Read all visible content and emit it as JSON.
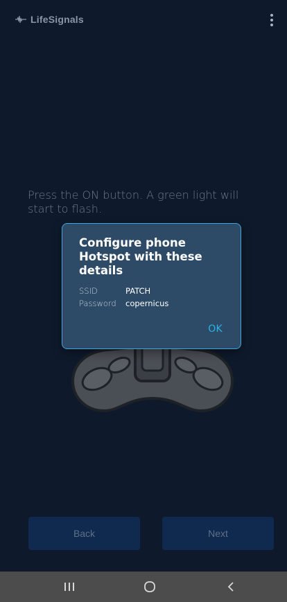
{
  "app": {
    "brand_name": "LifeSignals"
  },
  "instruction": {
    "text": "Press the ON button. A green light will start to flash."
  },
  "dialog": {
    "title": "Configure phone Hotspot with these details",
    "details": [
      {
        "label": "SSID",
        "value": "PATCH"
      },
      {
        "label": "Password",
        "value": "copernicus"
      }
    ],
    "ok_label": "OK"
  },
  "buttons": {
    "back_label": "Back",
    "next_label": "Next"
  },
  "icons": {
    "menu": "more-vert-icon",
    "logo": "heartbeat-logo-icon",
    "nav_recents": "recents-icon",
    "nav_home": "home-icon",
    "nav_back": "back-icon"
  },
  "colors": {
    "background": "#0e1a2b",
    "dialog_background": "#2d4a66",
    "dialog_border": "#3fa6e0",
    "accent": "#27b5ec",
    "button_background": "#0f2a4e",
    "nav_bar": "#4c4c4c"
  }
}
